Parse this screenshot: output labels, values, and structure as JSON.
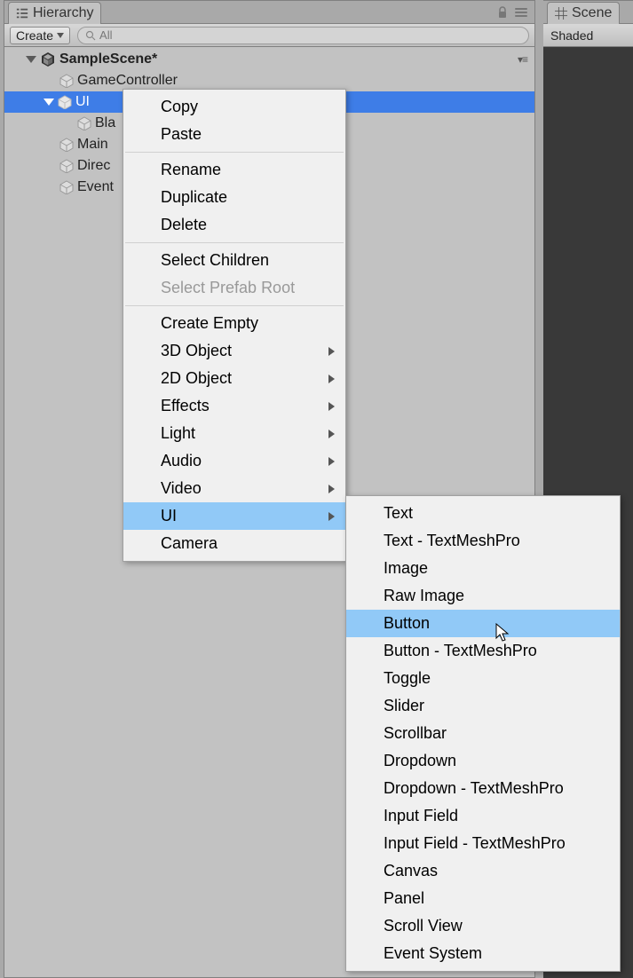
{
  "tabs": {
    "hierarchy": "Hierarchy",
    "scene": "Scene"
  },
  "toolbar": {
    "create": "Create",
    "search_placeholder": "All",
    "shaded": "Shaded"
  },
  "tree": {
    "scene": "SampleScene*",
    "items": [
      "GameController",
      "UI",
      "Bla",
      "Main",
      "Direc",
      "Event"
    ]
  },
  "context_menu": {
    "items": [
      "Copy",
      "Paste",
      "Rename",
      "Duplicate",
      "Delete",
      "Select Children",
      "Select Prefab Root",
      "Create Empty",
      "3D Object",
      "2D Object",
      "Effects",
      "Light",
      "Audio",
      "Video",
      "UI",
      "Camera"
    ]
  },
  "ui_submenu": {
    "items": [
      "Text",
      "Text - TextMeshPro",
      "Image",
      "Raw Image",
      "Button",
      "Button - TextMeshPro",
      "Toggle",
      "Slider",
      "Scrollbar",
      "Dropdown",
      "Dropdown - TextMeshPro",
      "Input Field",
      "Input Field - TextMeshPro",
      "Canvas",
      "Panel",
      "Scroll View",
      "Event System"
    ]
  }
}
